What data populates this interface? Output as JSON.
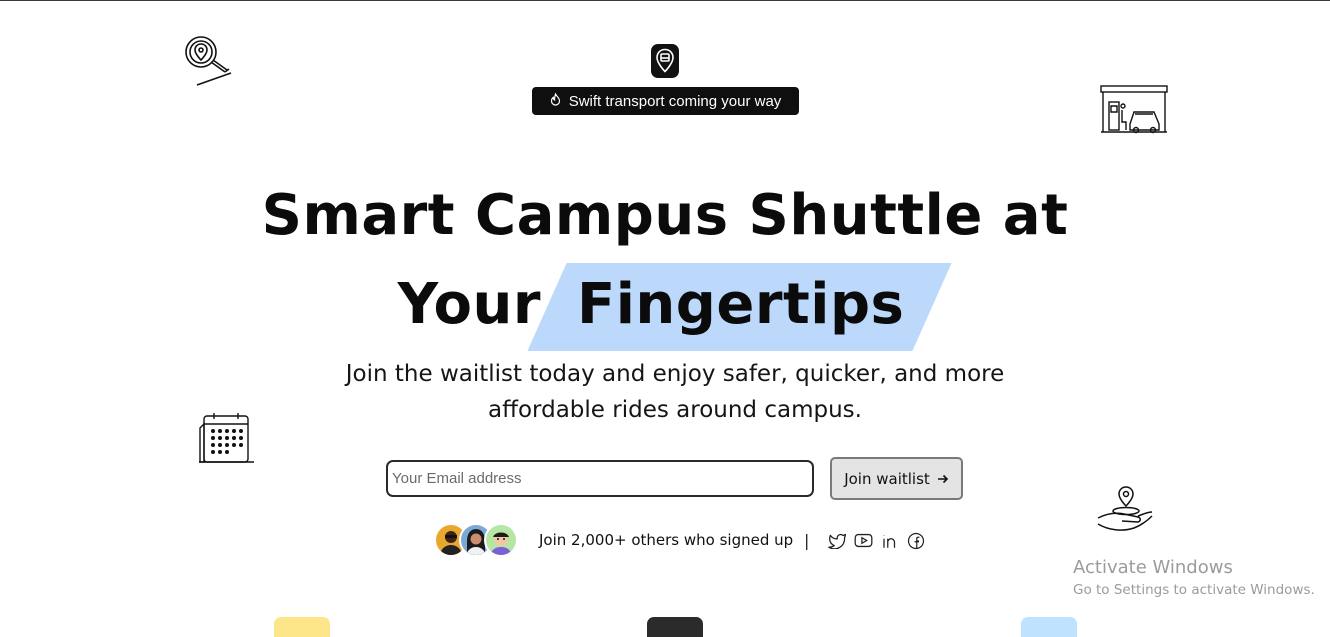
{
  "badge": {
    "text": "Swift transport coming your way",
    "icon": "fire-icon"
  },
  "hero": {
    "title_line1": "Smart Campus Shuttle at",
    "title_line2_plain": "Your",
    "title_line2_highlight": "Fingertips",
    "highlight_color": "#bcd9fb",
    "subtitle": "Join the waitlist today and enjoy safer, quicker, and more affordable rides around campus."
  },
  "signup": {
    "email_placeholder": "Your Email address",
    "email_value": "",
    "button_label": "Join waitlist",
    "button_icon": "arrow-right-icon"
  },
  "social_proof": {
    "text": "Join 2,000+ others who signed up",
    "separator": "|",
    "icons": [
      "twitter-icon",
      "youtube-icon",
      "linkedin-icon",
      "facebook-icon"
    ]
  },
  "decorations": [
    "map-search-icon",
    "gas-station-icon",
    "calendar-icon",
    "location-hand-icon"
  ],
  "windows_watermark": {
    "title": "Activate Windows",
    "subtitle": "Go to Settings to activate Windows."
  },
  "colors": {
    "brand_dark": "#111111",
    "card_yellow": "#fde68a",
    "card_dark": "#2b2b2b",
    "card_blue": "#bfe3ff"
  }
}
